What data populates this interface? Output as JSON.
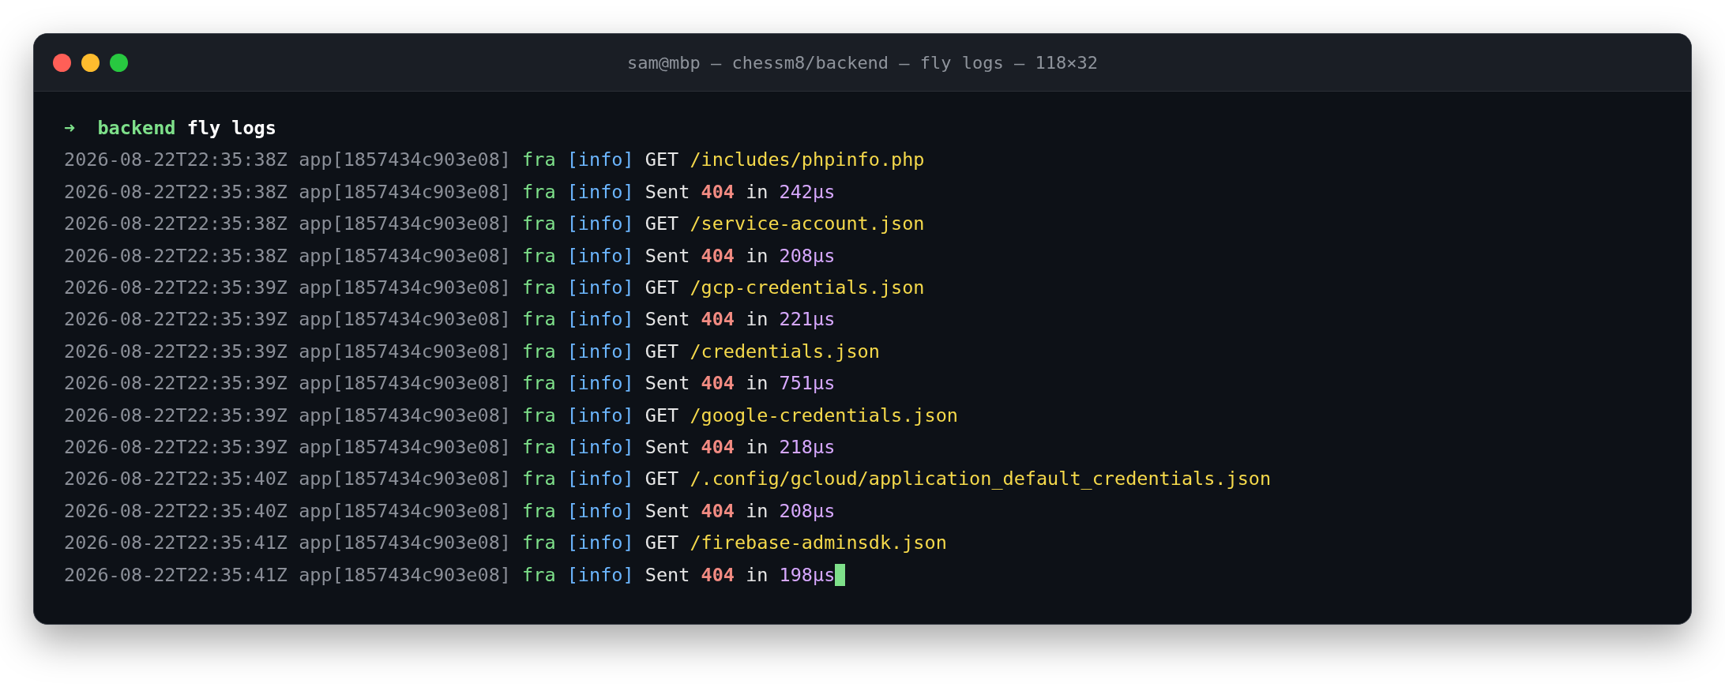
{
  "window": {
    "title": "sam@mbp — chessm8/backend — fly logs — 118×32"
  },
  "prompt": {
    "arrow": "➜",
    "directory": "backend",
    "command": "fly logs"
  },
  "lines": [
    {
      "kind": "request",
      "timestamp": "2026-08-22T22:35:38Z",
      "app": "app[1857434c903e08]",
      "region": "fra",
      "level": "[info]",
      "method": "GET",
      "path": "/includes/phpinfo.php"
    },
    {
      "kind": "response",
      "timestamp": "2026-08-22T22:35:38Z",
      "app": "app[1857434c903e08]",
      "region": "fra",
      "level": "[info]",
      "verb": "Sent",
      "status": "404",
      "preposition": "in",
      "duration": "242µs"
    },
    {
      "kind": "request",
      "timestamp": "2026-08-22T22:35:38Z",
      "app": "app[1857434c903e08]",
      "region": "fra",
      "level": "[info]",
      "method": "GET",
      "path": "/service-account.json"
    },
    {
      "kind": "response",
      "timestamp": "2026-08-22T22:35:38Z",
      "app": "app[1857434c903e08]",
      "region": "fra",
      "level": "[info]",
      "verb": "Sent",
      "status": "404",
      "preposition": "in",
      "duration": "208µs"
    },
    {
      "kind": "request",
      "timestamp": "2026-08-22T22:35:39Z",
      "app": "app[1857434c903e08]",
      "region": "fra",
      "level": "[info]",
      "method": "GET",
      "path": "/gcp-credentials.json"
    },
    {
      "kind": "response",
      "timestamp": "2026-08-22T22:35:39Z",
      "app": "app[1857434c903e08]",
      "region": "fra",
      "level": "[info]",
      "verb": "Sent",
      "status": "404",
      "preposition": "in",
      "duration": "221µs"
    },
    {
      "kind": "request",
      "timestamp": "2026-08-22T22:35:39Z",
      "app": "app[1857434c903e08]",
      "region": "fra",
      "level": "[info]",
      "method": "GET",
      "path": "/credentials.json"
    },
    {
      "kind": "response",
      "timestamp": "2026-08-22T22:35:39Z",
      "app": "app[1857434c903e08]",
      "region": "fra",
      "level": "[info]",
      "verb": "Sent",
      "status": "404",
      "preposition": "in",
      "duration": "751µs"
    },
    {
      "kind": "request",
      "timestamp": "2026-08-22T22:35:39Z",
      "app": "app[1857434c903e08]",
      "region": "fra",
      "level": "[info]",
      "method": "GET",
      "path": "/google-credentials.json"
    },
    {
      "kind": "response",
      "timestamp": "2026-08-22T22:35:39Z",
      "app": "app[1857434c903e08]",
      "region": "fra",
      "level": "[info]",
      "verb": "Sent",
      "status": "404",
      "preposition": "in",
      "duration": "218µs"
    },
    {
      "kind": "request",
      "timestamp": "2026-08-22T22:35:40Z",
      "app": "app[1857434c903e08]",
      "region": "fra",
      "level": "[info]",
      "method": "GET",
      "path": "/.config/gcloud/application_default_credentials.json"
    },
    {
      "kind": "response",
      "timestamp": "2026-08-22T22:35:40Z",
      "app": "app[1857434c903e08]",
      "region": "fra",
      "level": "[info]",
      "verb": "Sent",
      "status": "404",
      "preposition": "in",
      "duration": "208µs"
    },
    {
      "kind": "request",
      "timestamp": "2026-08-22T22:35:41Z",
      "app": "app[1857434c903e08]",
      "region": "fra",
      "level": "[info]",
      "method": "GET",
      "path": "/firebase-adminsdk.json"
    },
    {
      "kind": "response",
      "timestamp": "2026-08-22T22:35:41Z",
      "app": "app[1857434c903e08]",
      "region": "fra",
      "level": "[info]",
      "verb": "Sent",
      "status": "404",
      "preposition": "in",
      "duration": "198µs"
    }
  ],
  "cursor": true
}
